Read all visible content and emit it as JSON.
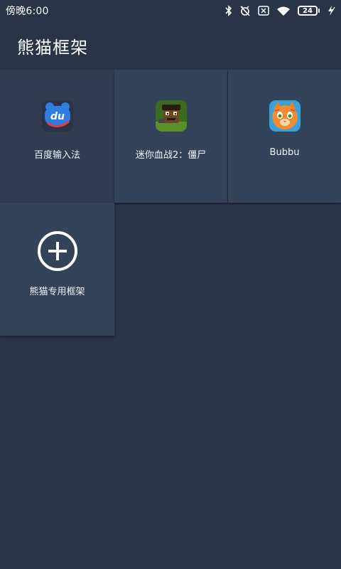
{
  "status_bar": {
    "time": "傍晚6:00",
    "battery_level": "24",
    "icons": [
      "bluetooth-icon",
      "alarm-off-icon",
      "sim-icon",
      "wifi-icon",
      "battery-icon",
      "charging-icon"
    ]
  },
  "app_bar": {
    "title": "熊猫框架"
  },
  "apps": [
    {
      "label": "百度输入法",
      "icon": "baidu-input-icon"
    },
    {
      "label": "迷你血战2：僵尸",
      "icon": "mini-blood-war-icon"
    },
    {
      "label": "Bubbu",
      "icon": "bubbu-cat-icon"
    },
    {
      "label": "熊猫专用框架",
      "icon": "add-circle-icon"
    }
  ],
  "colors": {
    "background": "#2a3449",
    "tile": "#33435a",
    "baidu_blue": "#2f7de1",
    "text": "#ffffff"
  }
}
